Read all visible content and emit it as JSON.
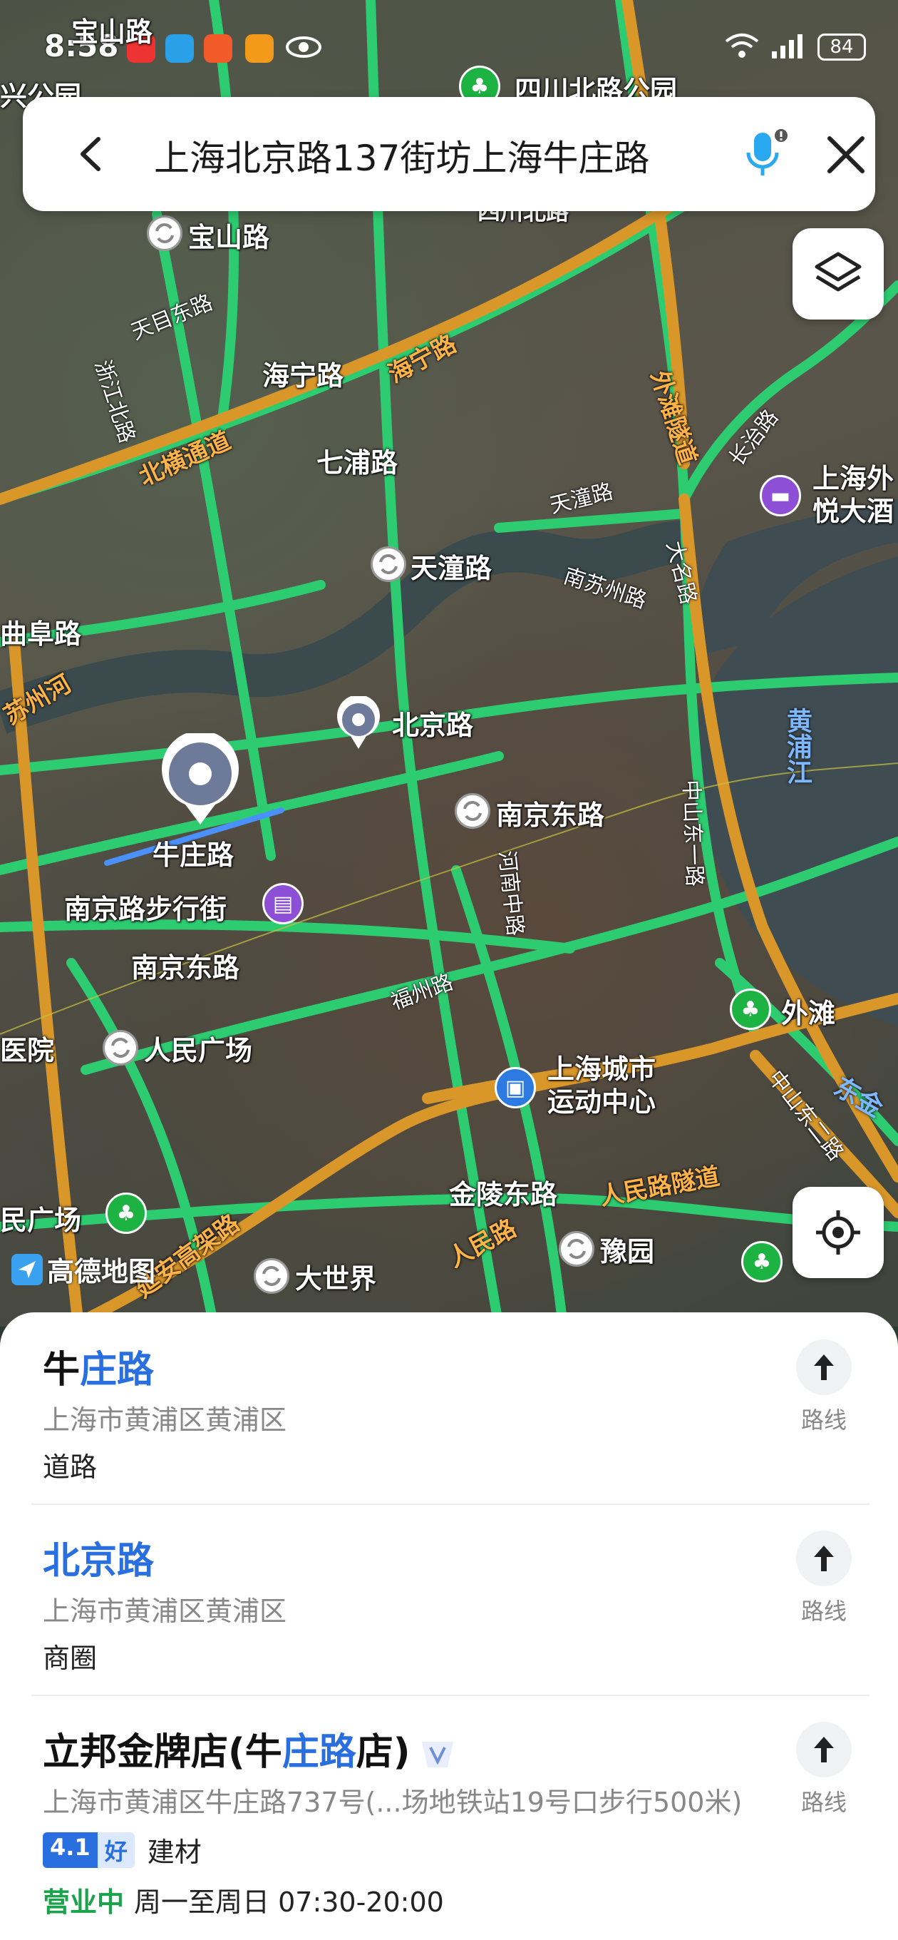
{
  "status_bar": {
    "time": "8:58",
    "battery": "84"
  },
  "search": {
    "query": "上海北京路137街坊上海牛庄路"
  },
  "map": {
    "place_labels": {
      "baoshan_top": "宝山路",
      "baoshan": "宝山路",
      "sichuan_park": "四川北路公园",
      "xinggongyuan": "兴公园",
      "sichuan_n": "四川北路",
      "tianmu_e": "天目东路",
      "zhejiang_n": "浙江北路",
      "haining": "海宁路",
      "haining2": "海宁路",
      "beiheng": "北横通道",
      "qipu": "七浦路",
      "waitan_tunnel": "外滩隧道",
      "changzhi": "长治路",
      "hotel": "上海外\n悦大酒",
      "tiantong_small": "天潼路",
      "tiantong": "天潼路",
      "nansuzhou": "南苏州路",
      "daming": "大名路",
      "qufu": "曲阜路",
      "suzhou_river": "苏州河",
      "beijing_rd": "北京路",
      "huangpu_river": "黄浦江",
      "nanjing_e_metro": "南京东路",
      "zhongshan_e1": "中山东一路",
      "henan_m": "河南中路",
      "niuzhuang": "牛庄路",
      "pedestrian": "南京路步行街",
      "nanjing_e": "南京东路",
      "fuzhou": "福州路",
      "waitan": "外滩",
      "hospital": "医院",
      "peoples_square": "人民广场",
      "sports_center": "上海城市\n运动中心",
      "zhongshan_e2": "中山东二路",
      "dongjin": "东金",
      "jinling_e": "金陵东路",
      "renmin_tunnel": "人民路隧道",
      "peoples_square2": "民广场",
      "yanan_elevated": "延安高架路",
      "dashijie": "大世界",
      "renmin_rd": "人民路",
      "yuyuan": "豫园"
    },
    "logo": "高德地图"
  },
  "results": [
    {
      "title_plain": "牛",
      "title_hl": "庄路",
      "title_tail": "",
      "address": "上海市黄浦区黄浦区",
      "category": "道路",
      "route_label": "路线"
    },
    {
      "title_plain": "",
      "title_hl": "北京路",
      "title_tail": "",
      "address": "上海市黄浦区黄浦区",
      "category": "商圈",
      "route_label": "路线"
    },
    {
      "title_plain": "立邦金牌店(牛",
      "title_hl": "庄路",
      "title_tail": "店)",
      "address": "上海市黄浦区牛庄路737号(...场地铁站19号口步行500米)",
      "rating_score": "4.1",
      "rating_word": "好",
      "category": "建材",
      "open_status": "营业中",
      "hours": "周一至周日 07:30-20:00",
      "route_label": "路线"
    }
  ],
  "colors": {
    "accent": "#2a6fe0",
    "road": "#2ecc71",
    "highway": "#e0a030",
    "open": "#1aa34a"
  }
}
